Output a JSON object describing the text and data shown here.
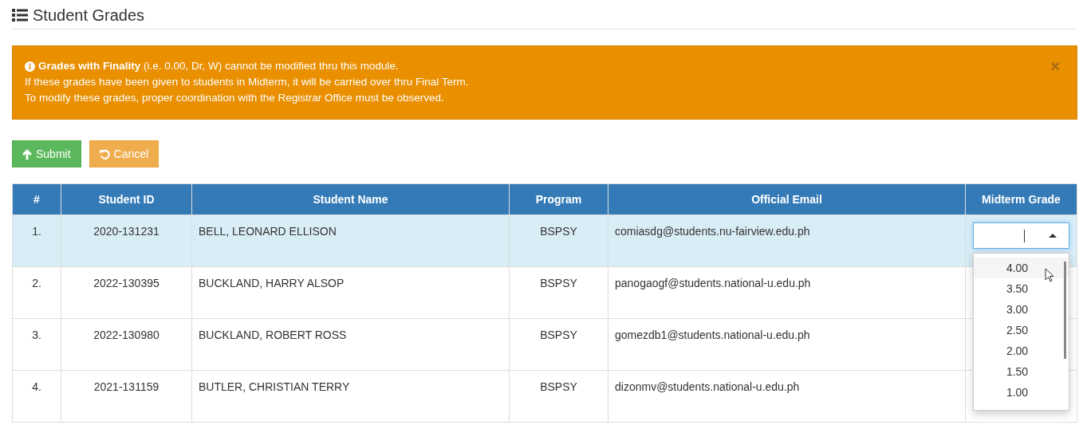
{
  "title": "Student Grades",
  "alert": {
    "lead": "Grades with Finality",
    "lines": [
      "(i.e. 0.00, Dr, W) cannot be modified thru this module.",
      "If these grades have been given to students in Midterm, it will be carried over thru Final Term.",
      "To modify these grades, proper coordination with the Registrar Office must be observed."
    ],
    "close": "×"
  },
  "buttons": [
    {
      "label": "Submit",
      "kind": "submit"
    },
    {
      "label": "Cancel",
      "kind": "cancel"
    }
  ],
  "table": {
    "columns": [
      "#",
      "Student ID",
      "Student Name",
      "Program",
      "Official Email",
      "Midterm Grade"
    ],
    "rows": [
      {
        "no": "1.",
        "id": "2020-131231",
        "name": "BELL, LEONARD ELLISON",
        "program": "BSPSY",
        "email": "comiasdg@students.nu-fairview.edu.ph",
        "selected": true,
        "grade_open": true
      },
      {
        "no": "2.",
        "id": "2022-130395",
        "name": "BUCKLAND, HARRY ALSOP",
        "program": "BSPSY",
        "email": "panogaogf@students.national-u.edu.ph",
        "selected": false,
        "grade_open": false
      },
      {
        "no": "3.",
        "id": "2022-130980",
        "name": "BUCKLAND, ROBERT ROSS",
        "program": "BSPSY",
        "email": "gomezdb1@students.national-u.edu.ph",
        "selected": false,
        "grade_open": false
      },
      {
        "no": "4.",
        "id": "2021-131159",
        "name": "BUTLER, CHRISTIAN TERRY",
        "program": "BSPSY",
        "email": "dizonmv@students.national-u.edu.ph",
        "selected": false,
        "grade_open": false
      }
    ]
  },
  "grade_options": [
    {
      "label": "4.00",
      "highlighted": true
    },
    {
      "label": "3.50",
      "highlighted": false
    },
    {
      "label": "3.00",
      "highlighted": false
    },
    {
      "label": "2.50",
      "highlighted": false
    },
    {
      "label": "2.00",
      "highlighted": false
    },
    {
      "label": "1.50",
      "highlighted": false
    },
    {
      "label": "1.00",
      "highlighted": false
    }
  ]
}
